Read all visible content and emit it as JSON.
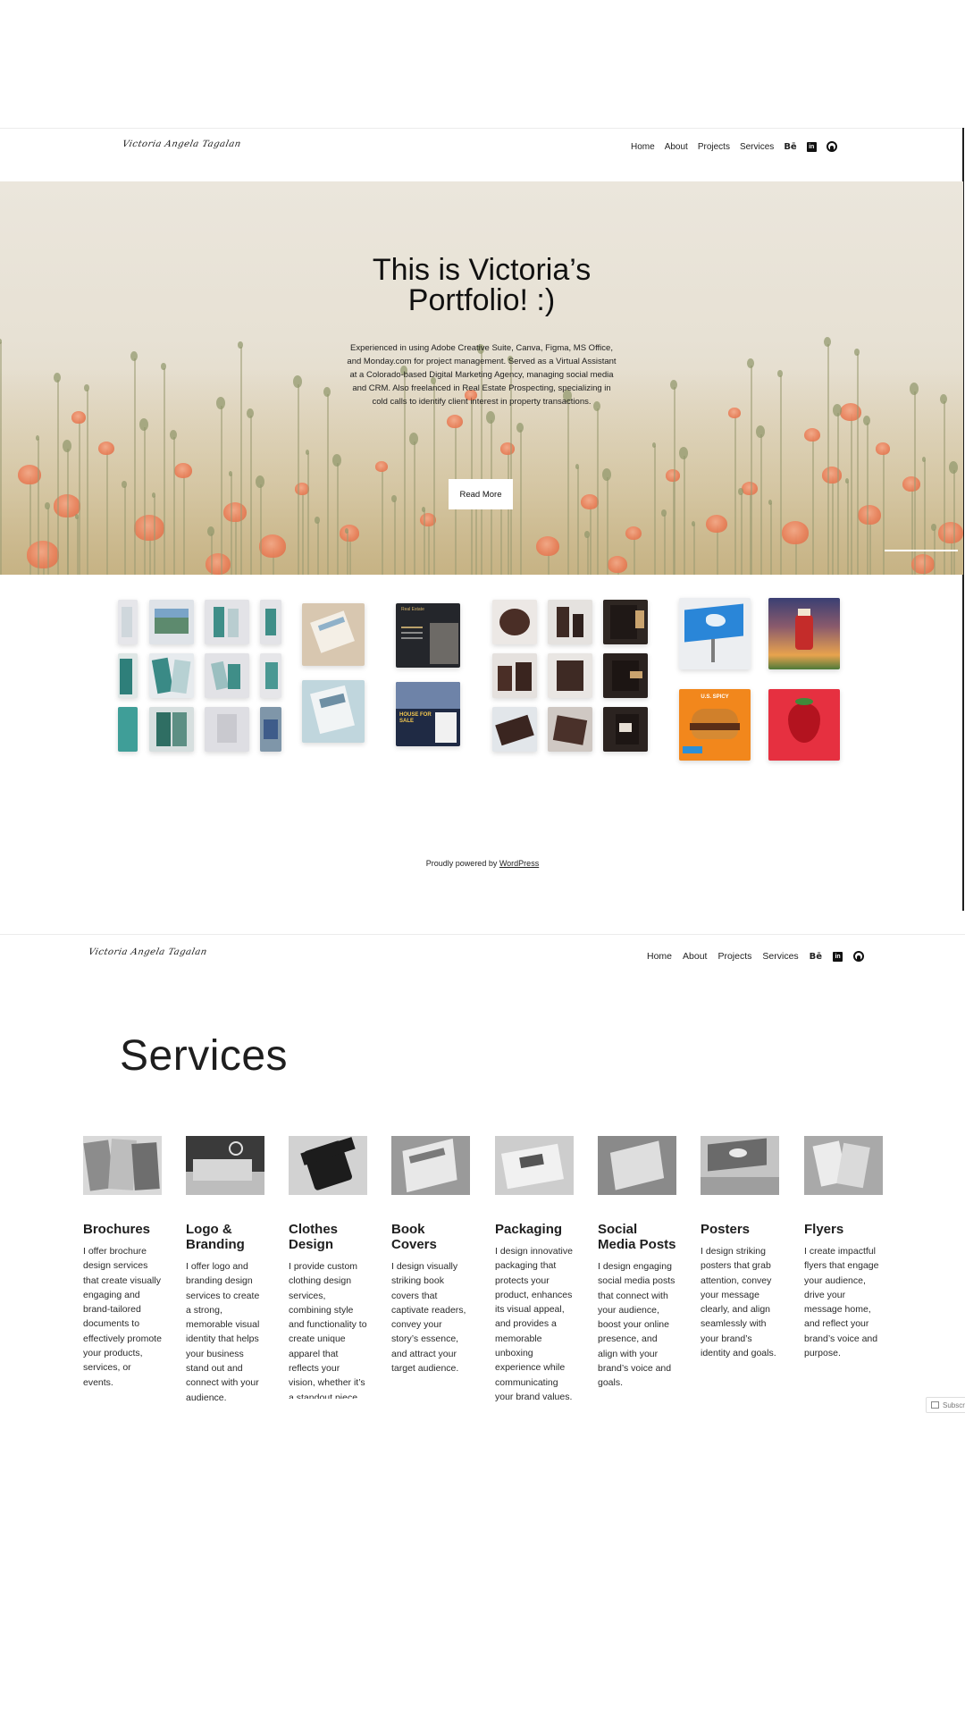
{
  "site": {
    "logo_text": "Victoria Angela Tagalan"
  },
  "nav": {
    "items": [
      "Home",
      "About",
      "Projects",
      "Services"
    ],
    "social": {
      "behance": "Bē",
      "linkedin": "in"
    }
  },
  "hero": {
    "title_line1": "This is Victoria’s",
    "title_line2": "Portfolio! :)",
    "text": "Experienced in using Adobe Creative Suite, Canva, Figma, MS Office, and Monday.com for project management. Served as a Virtual Assistant at a Colorado-based Digital Marketing Agency, managing social media and CRM. Also freelanced in Real Estate Prospecting, specializing in cold calls to identify client interest in property transactions.",
    "button_label": "Read More"
  },
  "gallery": {
    "real_estate_flyer_text": [
      "Real Estate",
      "HOUSE FOR SALE"
    ],
    "burger_poster_text": "U.S. SPICY"
  },
  "footer": {
    "prefix": "Proudly powered by",
    "link": "WordPress"
  },
  "services": {
    "title": "Services",
    "items": [
      {
        "title": "Brochures",
        "text": "I offer brochure design services that create visually engaging and brand-tailored documents to effectively promote your products, services, or events."
      },
      {
        "title": "Logo & Branding",
        "text": "I offer logo and branding design services to create a strong, memorable visual identity that helps your business stand out and connect with your audience."
      },
      {
        "title": "Clothes Design",
        "text": "I provide custom clothing design services, combining style and functionality to create unique apparel that reflects your vision, whether it’s a standout piece or a cohesive"
      },
      {
        "title": "Book Covers",
        "text": "I design visually striking book covers that captivate readers, convey your story’s essence, and attract your target audience."
      },
      {
        "title": "Packaging",
        "text": "I design innovative packaging that protects your product, enhances its visual appeal, and provides a memorable unboxing experience while communicating your brand values."
      },
      {
        "title": "Social Media Posts",
        "text": "I design engaging social media posts that connect with your audience, boost your online presence, and align with your brand’s voice and goals."
      },
      {
        "title": "Posters",
        "text": "I design striking posters that grab attention, convey your message clearly, and align seamlessly with your brand’s identity and goals."
      },
      {
        "title": "Flyers",
        "text": "I create impactful flyers that engage your audience, drive your message home, and reflect your brand’s voice and purpose."
      }
    ]
  },
  "subscribe": {
    "label": "Subscribe"
  },
  "colors": {
    "text": "#1e1e1e",
    "poppy": "#ea7f59",
    "hero_bg": "#e7e1d4"
  }
}
